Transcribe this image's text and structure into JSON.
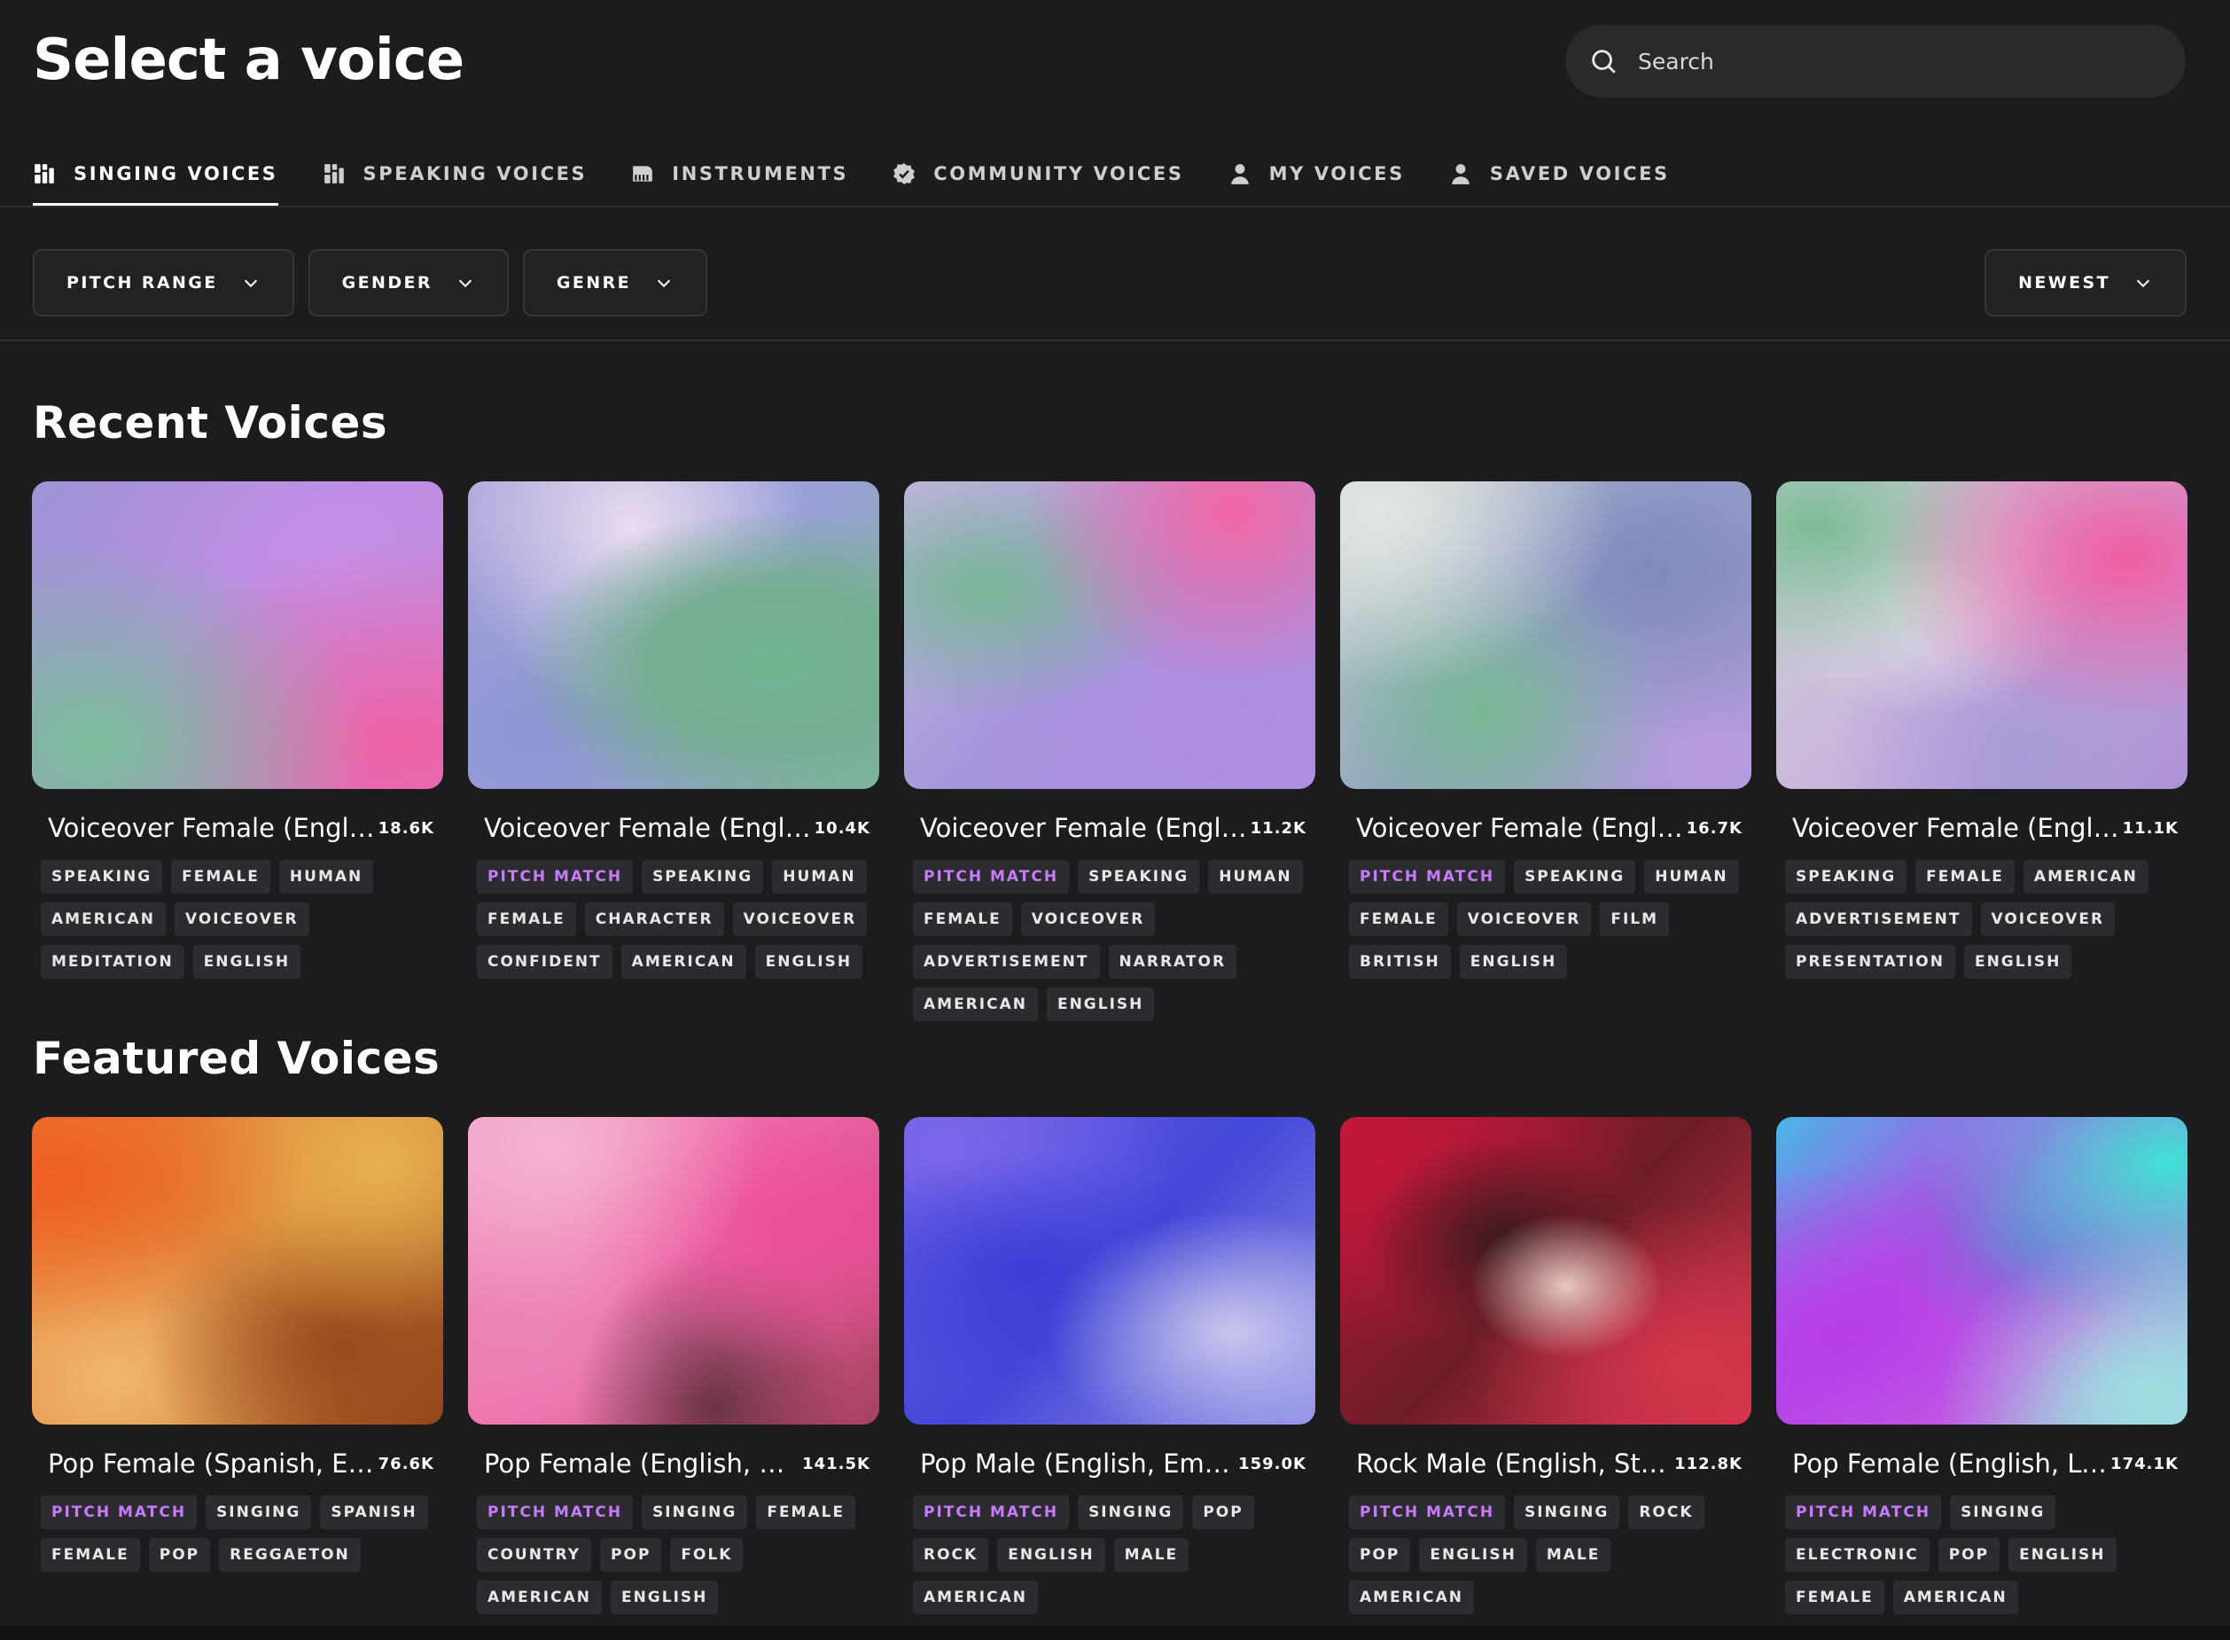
{
  "header": {
    "title": "Select a voice",
    "search_placeholder": "Search"
  },
  "tabs": [
    {
      "label": "SINGING VOICES",
      "icon": "singing-icon",
      "active": true
    },
    {
      "label": "SPEAKING VOICES",
      "icon": "speaking-icon",
      "active": false
    },
    {
      "label": "INSTRUMENTS",
      "icon": "piano-icon",
      "active": false
    },
    {
      "label": "COMMUNITY VOICES",
      "icon": "verified-badge-icon",
      "active": false
    },
    {
      "label": "MY VOICES",
      "icon": "person-icon",
      "active": false
    },
    {
      "label": "SAVED VOICES",
      "icon": "person-icon",
      "active": false
    }
  ],
  "filters": {
    "pitch_range": "PITCH RANGE",
    "gender": "GENDER",
    "genre": "GENRE",
    "sort": "NEWEST"
  },
  "colors": {
    "background": "#1c1c1e",
    "tag_background": "#2c2c30",
    "accent_tag": "#c77bff"
  },
  "recent": {
    "title": "Recent Voices",
    "cards": [
      {
        "title": "Voiceover Female (Englis...",
        "plays": "18.6K",
        "tags": [
          "SPEAKING",
          "FEMALE",
          "HUMAN",
          "AMERICAN",
          "VOICEOVER",
          "MEDITATION",
          "ENGLISH"
        ]
      },
      {
        "title": "Voiceover Female (Englis...",
        "plays": "10.4K",
        "tags": [
          "PITCH MATCH",
          "SPEAKING",
          "HUMAN",
          "FEMALE",
          "CHARACTER",
          "VOICEOVER",
          "CONFIDENT",
          "AMERICAN",
          "ENGLISH"
        ]
      },
      {
        "title": "Voiceover Female (Englis...",
        "plays": "11.2K",
        "tags": [
          "PITCH MATCH",
          "SPEAKING",
          "HUMAN",
          "FEMALE",
          "VOICEOVER",
          "ADVERTISEMENT",
          "NARRATOR",
          "AMERICAN",
          "ENGLISH"
        ]
      },
      {
        "title": "Voiceover Female (English...",
        "plays": "16.7K",
        "tags": [
          "PITCH MATCH",
          "SPEAKING",
          "HUMAN",
          "FEMALE",
          "VOICEOVER",
          "FILM",
          "BRITISH",
          "ENGLISH"
        ]
      },
      {
        "title": "Voiceover Female (Englis...",
        "plays": "11.1K",
        "tags": [
          "SPEAKING",
          "FEMALE",
          "AMERICAN",
          "ADVERTISEMENT",
          "VOICEOVER",
          "PRESENTATION",
          "ENGLISH"
        ]
      }
    ]
  },
  "featured": {
    "title": "Featured Voices",
    "cards": [
      {
        "title": "Pop Female (Spanish, En...",
        "plays": "76.6K",
        "tags": [
          "PITCH MATCH",
          "SINGING",
          "SPANISH",
          "FEMALE",
          "POP",
          "REGGAETON"
        ]
      },
      {
        "title": "Pop Female (English, Co...",
        "plays": "141.5K",
        "tags": [
          "PITCH MATCH",
          "SINGING",
          "FEMALE",
          "COUNTRY",
          "POP",
          "FOLK",
          "AMERICAN",
          "ENGLISH"
        ]
      },
      {
        "title": "Pop Male (English, Emo, ...",
        "plays": "159.0K",
        "tags": [
          "PITCH MATCH",
          "SINGING",
          "POP",
          "ROCK",
          "ENGLISH",
          "MALE",
          "AMERICAN"
        ]
      },
      {
        "title": "Rock Male (English, Stra...",
        "plays": "112.8K",
        "tags": [
          "PITCH MATCH",
          "SINGING",
          "ROCK",
          "POP",
          "ENGLISH",
          "MALE",
          "AMERICAN"
        ]
      },
      {
        "title": "Pop Female (English, Lo...",
        "plays": "174.1K",
        "tags": [
          "PITCH MATCH",
          "SINGING",
          "ELECTRONIC",
          "POP",
          "ENGLISH",
          "FEMALE",
          "AMERICAN"
        ]
      }
    ]
  }
}
